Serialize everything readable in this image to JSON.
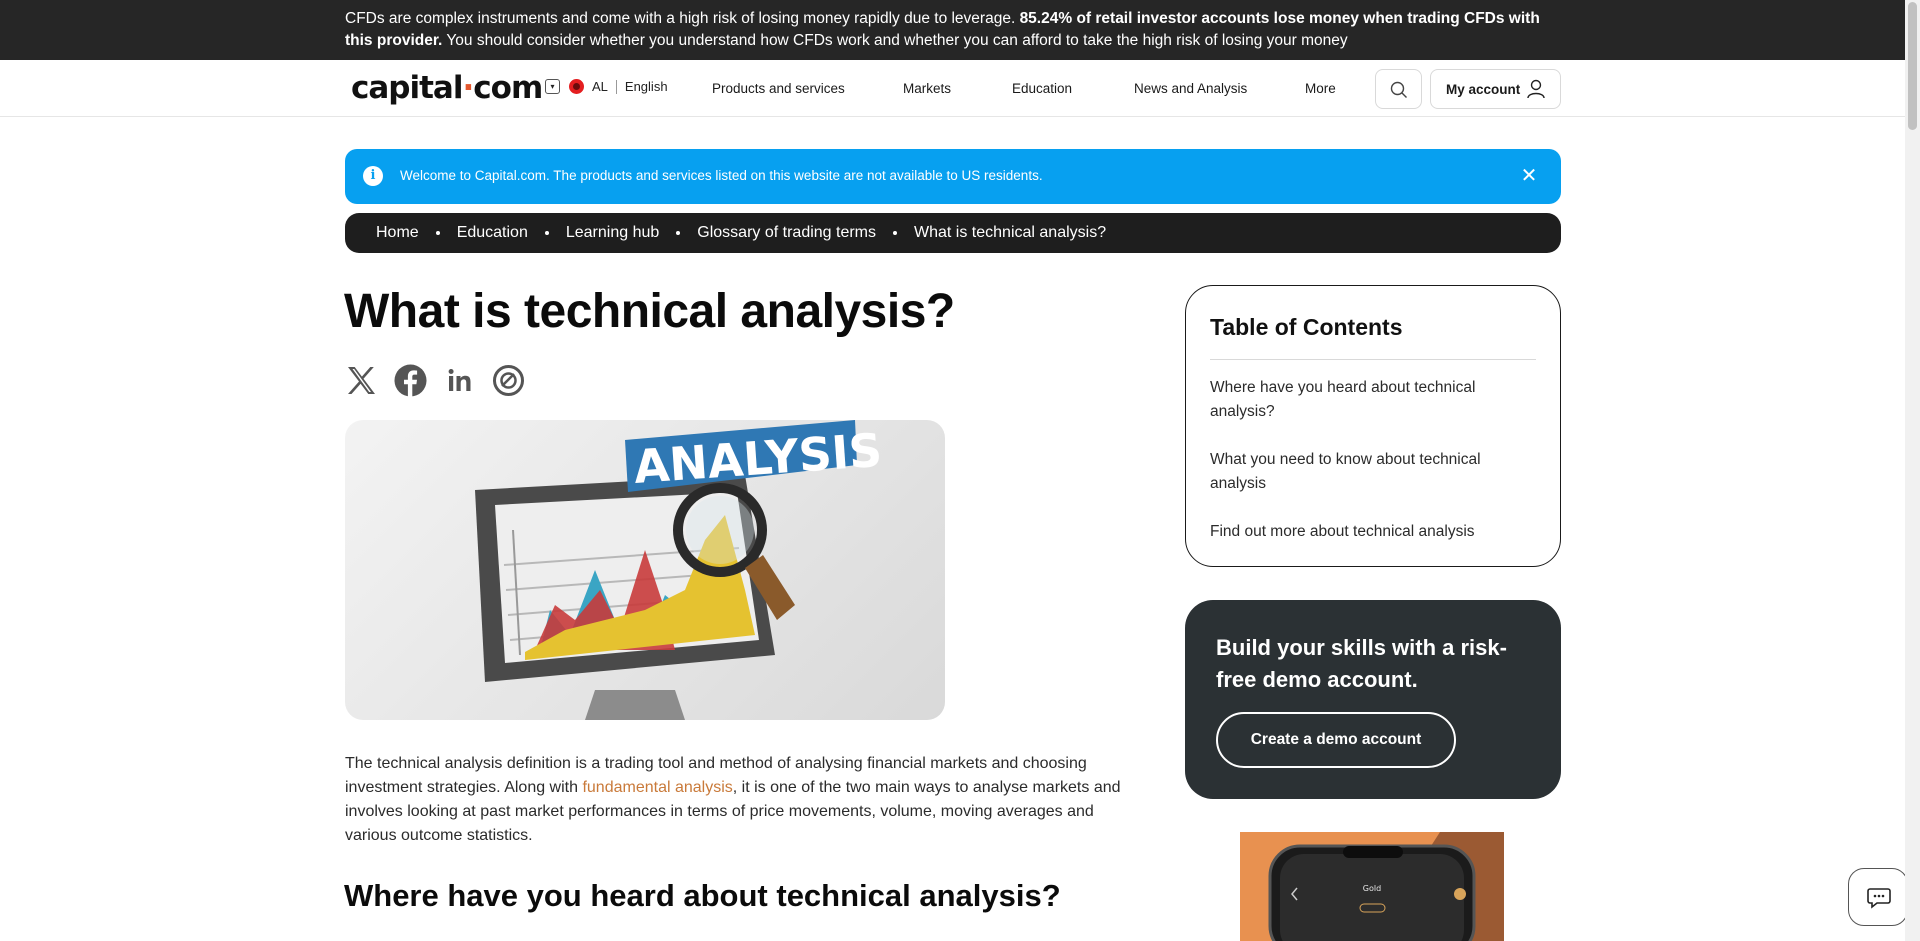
{
  "risk_banner": {
    "text_part1": "CFDs are complex instruments and come with a high risk of losing money rapidly due to leverage. ",
    "text_bold": "85.24% of retail investor accounts lose money when trading CFDs with this provider.",
    "text_part2": " You should consider whether you understand how CFDs work and whether you can afford to take the high risk of losing your money"
  },
  "header": {
    "logo_part1": "capital",
    "logo_dot": "·",
    "logo_part2": "com",
    "country": "AL",
    "language": "English",
    "nav": [
      "Products and services",
      "Markets",
      "Education",
      "News and Analysis",
      "More"
    ],
    "account_label": "My account"
  },
  "notice": {
    "message": "Welcome to Capital.com. The products and services listed on this website are not available to US residents.",
    "close": "✕",
    "info_glyph": "i"
  },
  "breadcrumb": [
    "Home",
    "Education",
    "Learning hub",
    "Glossary of trading terms",
    "What is technical analysis?"
  ],
  "article": {
    "title": "What is technical analysis?",
    "hero_word": "ANALYSIS",
    "intro_part1": "The technical analysis definition is a trading tool and method of analysing financial markets and choosing investment strategies. Along with ",
    "intro_link": "fundamental analysis",
    "intro_part2": ", it is one of the two main ways to analyse markets and involves looking at past market performances in terms of price movements, volume, moving averages and various outcome statistics.",
    "section1_title": "Where have you heard about technical analysis?"
  },
  "toc": {
    "title": "Table of Contents",
    "items": [
      "Where have you heard about technical analysis?",
      "What you need to know about technical analysis",
      "Find out more about technical analysis"
    ]
  },
  "demo": {
    "promo": "Build your skills with a risk-free demo account.",
    "button": "Create a demo account"
  },
  "app_promo": {
    "phone_label": "Gold"
  },
  "icons": [
    "chevron-down-icon",
    "flag-icon",
    "search-icon",
    "user-icon",
    "info-icon",
    "close-icon",
    "x-icon",
    "facebook-icon",
    "linkedin-icon",
    "share-icon",
    "chat-icon"
  ],
  "colors": {
    "banner": "#262626",
    "notice": "#07a0f0",
    "breadcrumb": "#1e1e1e",
    "demo": "#2b3134",
    "link": "#c97a3a",
    "accent": "#e4572e"
  }
}
